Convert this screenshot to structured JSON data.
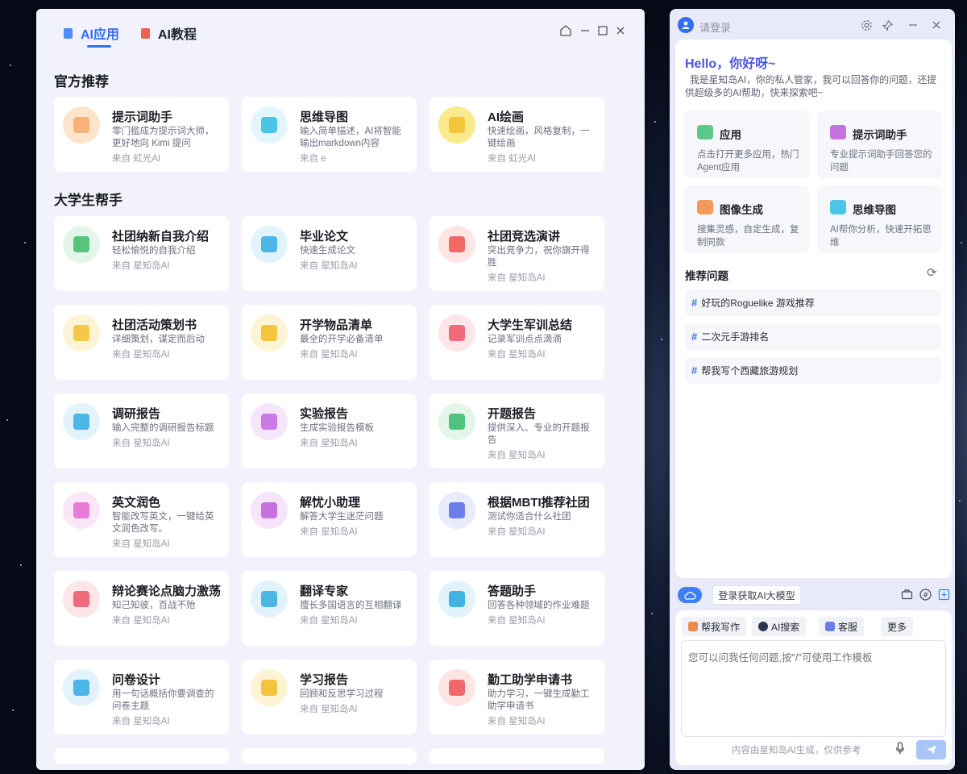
{
  "left_window": {
    "tabs": [
      {
        "label": "AI应用",
        "icon": "document-icon",
        "active": true
      },
      {
        "label": "AI教程",
        "icon": "tutorial-icon",
        "active": false
      }
    ],
    "sections": {
      "official": {
        "title": "官方推荐",
        "cards": [
          {
            "title": "提示词助手",
            "desc": "零门槛成为提示词大师，更好地向 Kimi 提问",
            "source": "来自 虹光AI",
            "icon": "chat-bubble-icon",
            "color": "#f6b27a",
            "bg": "#fde4cc"
          },
          {
            "title": "思维导图",
            "desc": "输入简单描述，AI将智能输出markdown内容",
            "source": "来自 e",
            "icon": "mindmap-icon",
            "color": "#4cc4e6",
            "bg": "#e3f6fb"
          },
          {
            "title": "AI绘画",
            "desc": "快速绘画，风格复制，一键绘画",
            "source": "来自 虹光AI",
            "icon": "paint-icon",
            "color": "#f3c63a",
            "bg": "#fbe98d"
          }
        ]
      },
      "college": {
        "title": "大学生帮手",
        "cards": [
          {
            "title": "社团纳新自我介绍",
            "desc": "轻松愉悦的自我介绍",
            "source": "来自 星知岛AI",
            "icon": "person-icon",
            "color": "#58c47b",
            "bg": "#e3f6e9"
          },
          {
            "title": "毕业论文",
            "desc": "快速生成论文",
            "source": "来自 星知岛AI",
            "icon": "translate-doc-icon",
            "color": "#4cb6e6",
            "bg": "#e3f3fb"
          },
          {
            "title": "社团竞选演讲",
            "desc": "突出竞争力，祝你旗开得胜",
            "source": "来自 星知岛AI",
            "icon": "smile-icon",
            "color": "#ef6a64",
            "bg": "#fde5e4"
          },
          {
            "title": "社团活动策划书",
            "desc": "详细策划，谋定而后动",
            "source": "来自 星知岛AI",
            "icon": "plan-icon",
            "color": "#f5c84a",
            "bg": "#fdf4d6"
          },
          {
            "title": "开学物品清单",
            "desc": "最全的开学必备清单",
            "source": "来自 星知岛AI",
            "icon": "list-icon",
            "color": "#f3c53f",
            "bg": "#fdf4d6"
          },
          {
            "title": "大学生军训总结",
            "desc": "记录军训点点滴滴",
            "source": "来自 星知岛AI",
            "icon": "edit-icon",
            "color": "#ef6a7a",
            "bg": "#fde5ea"
          },
          {
            "title": "调研报告",
            "desc": "输入完整的调研报告标题",
            "source": "来自 星知岛AI",
            "icon": "building-icon",
            "color": "#4cb6e6",
            "bg": "#e3f3fb"
          },
          {
            "title": "实验报告",
            "desc": "生成实验报告模板",
            "source": "来自 星知岛AI",
            "icon": "calendar-icon",
            "color": "#c97be6",
            "bg": "#f5e6fb"
          },
          {
            "title": "开题报告",
            "desc": "提供深入、专业的开题报告",
            "source": "来自 星知岛AI",
            "icon": "book-icon",
            "color": "#4fc37b",
            "bg": "#e3f6e9"
          },
          {
            "title": "英文润色",
            "desc": "智能改写英文，一键给英文润色改写。",
            "source": "来自 星知岛AI",
            "icon": "cube-icon",
            "color": "#e87bd6",
            "bg": "#fbe6f8"
          },
          {
            "title": "解忧小助理",
            "desc": "解答大学生迷茫问题",
            "source": "来自 星知岛AI",
            "icon": "robot-icon",
            "color": "#c770e0",
            "bg": "#f5e4fb"
          },
          {
            "title": "根据MBTI推荐社团",
            "desc": "测试你适合什么社团",
            "source": "来自 星知岛AI",
            "icon": "group-icon",
            "color": "#6b7fe6",
            "bg": "#e8ebfb"
          },
          {
            "title": "辩论赛论点脑力激荡",
            "desc": "知己知彼，百战不殆",
            "source": "来自 星知岛AI",
            "icon": "bulb-icon",
            "color": "#ef6a7a",
            "bg": "#fde5ea"
          },
          {
            "title": "翻译专家",
            "desc": "擅长多国语言的互相翻译",
            "source": "来自 星知岛AI",
            "icon": "translate-icon",
            "color": "#4cb6e6",
            "bg": "#e3f3fb"
          },
          {
            "title": "答题助手",
            "desc": "回答各种领域的作业难题",
            "source": "来自 星知岛AI",
            "icon": "check-person-icon",
            "color": "#3fb4e0",
            "bg": "#e3f3fb"
          },
          {
            "title": "问卷设计",
            "desc": "用一句话概括你要调查的问卷主题",
            "source": "来自 星知岛AI",
            "icon": "survey-icon",
            "color": "#4cb6e6",
            "bg": "#e3f3fb"
          },
          {
            "title": "学习报告",
            "desc": "回顾和反思学习过程",
            "source": "来自 星知岛AI",
            "icon": "report-icon",
            "color": "#f3c53f",
            "bg": "#fdf4d6"
          },
          {
            "title": "勤工助学申请书",
            "desc": "助力学习，一键生成勤工助学申请书",
            "source": "来自 星知岛AI",
            "icon": "application-icon",
            "color": "#ef6a6a",
            "bg": "#fde5e4"
          }
        ]
      }
    }
  },
  "right_panel": {
    "login": "请登录",
    "hello": "Hello，你好呀~",
    "intro": "我是星知岛AI，你的私人管家，我可以回答你的问题，还提供超级多的AI帮助，快来探索吧~",
    "features": [
      {
        "title": "应用",
        "desc": "点击打开更多应用，热门Agent应用",
        "icon": "apps-icon",
        "color": "#5cc98a"
      },
      {
        "title": "提示词助手",
        "desc": "专业提示词助手回答您的问题",
        "icon": "robot-icon",
        "color": "#c770e0"
      },
      {
        "title": "图像生成",
        "desc": "搜集灵感，自定生成，复制同款",
        "icon": "image-icon",
        "color": "#f39a5a"
      },
      {
        "title": "思维导图",
        "desc": "AI帮你分析，快速开拓思维",
        "icon": "mindmap-icon",
        "color": "#4cc4e6"
      }
    ],
    "recommend_title": "推荐问题",
    "recommend": [
      "好玩的Roguelike 游戏推荐",
      "二次元手游排名",
      "帮我写个西藏旅游规划"
    ],
    "login_model": "登录获取AI大模型",
    "chips": [
      "帮我写作",
      "AI搜索",
      "客服",
      "更多"
    ],
    "input_placeholder": "您可以问我任何问题,按\"/\"可使用工作模板",
    "footnote": "内容由星知岛AI生成，仅供参考"
  }
}
